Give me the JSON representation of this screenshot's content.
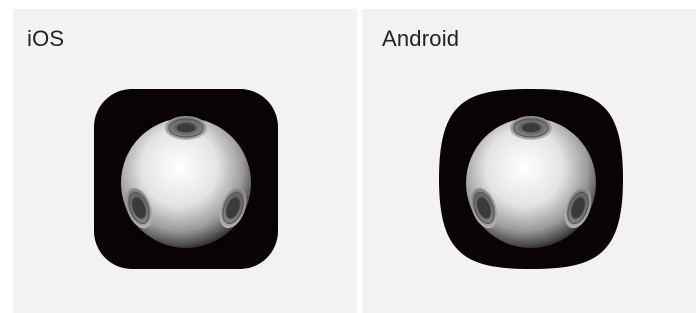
{
  "panels": [
    {
      "title": "iOS",
      "icon": "metal-ball-icon",
      "shape": "rounded-square"
    },
    {
      "title": "Android",
      "icon": "metal-ball-icon",
      "shape": "squircle"
    }
  ],
  "colors": {
    "panel_background": "#f2f2f2",
    "icon_background": "#0a0304",
    "text": "#222222"
  }
}
